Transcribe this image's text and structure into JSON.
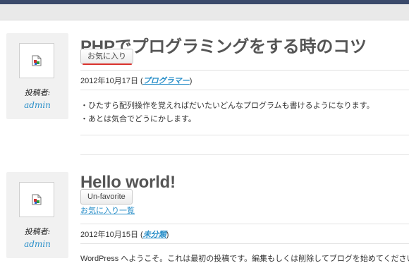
{
  "posts": [
    {
      "title": "PHPでプログラミングをする時のコツ",
      "favorite_button": "お気に入り",
      "date": "2012年10月17日",
      "category": "プログラマー",
      "author_label": "投稿者:",
      "author": "admin",
      "content_lines": [
        "・ひたすら配列操作を覚えればだいたいどんなプログラムも書けるようになります。",
        "・あとは気合でどうにかします。"
      ]
    },
    {
      "title": "Hello world!",
      "favorite_button": "Un-favorite",
      "favorites_list_link": "お気に入り一覧",
      "date": "2012年10月15日",
      "category": "未分類",
      "author_label": "投稿者:",
      "author": "admin",
      "content_lines": [
        "WordPress へようこそ。これは最初の投稿です。編集もしくは削除してブログを始めてください"
      ]
    }
  ],
  "colors": {
    "link": "#2a8fc9",
    "title": "#555555",
    "highlight_underline": "#d9312c",
    "top_bar": "#3b4a6b"
  },
  "icons": {
    "avatar": "broken-image-icon"
  }
}
